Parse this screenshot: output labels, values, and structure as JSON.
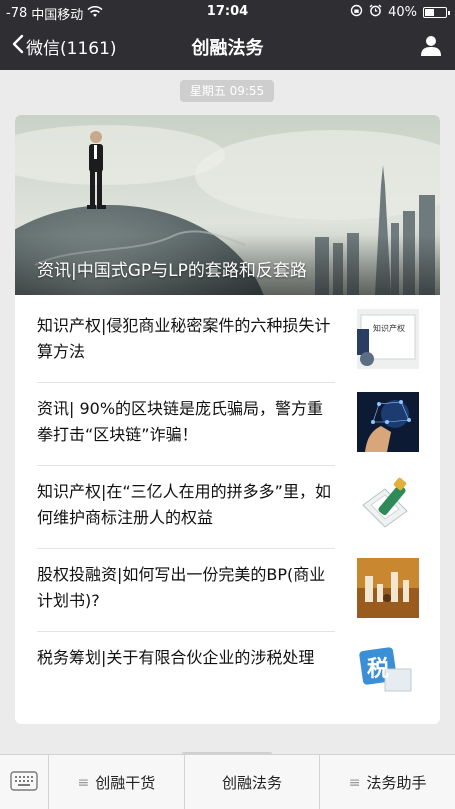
{
  "status_bar": {
    "signal": "-78",
    "carrier": "中国移动",
    "time": "17:04",
    "battery_percent": "40%",
    "battery_level": 0.4
  },
  "nav": {
    "back_label": "微信(1161)",
    "title": "创融法务"
  },
  "chat": {
    "timestamp": "星期五 09:55"
  },
  "cover_article": {
    "title": "资讯|中国式GP与LP的套路和反套路"
  },
  "articles": [
    {
      "title": "知识产权|侵犯商业秘密案件的六种损失计算方法",
      "thumb_text": "知识产权"
    },
    {
      "title": "资讯| 90%的区块链是庞氏骗局，警方重拳打击“区块链”诈骗！"
    },
    {
      "title": "知识产权|在“三亿人在用的拼多多”里，如何维护商标注册人的权益"
    },
    {
      "title": "股权投融资|如何写出一份完美的BP(商业计划书)?"
    },
    {
      "title": "税务筹划|关于有限合伙企业的涉税处理",
      "thumb_text": "税"
    }
  ],
  "menu": {
    "items": [
      {
        "label": "创融干货",
        "icon": "≡"
      },
      {
        "label": "创融法务"
      },
      {
        "label": "法务助手",
        "icon": "≡"
      }
    ]
  },
  "colors": {
    "bar_bg": "#2e2e33",
    "page_bg": "#ebebeb"
  }
}
